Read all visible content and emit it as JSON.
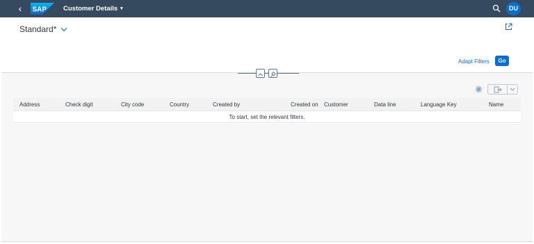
{
  "shell": {
    "back_glyph": "‹",
    "logo_text": "SAP",
    "app_title": "Customer Details",
    "caret": "▾",
    "avatar_initials": "DU",
    "bar_color": "#354a5f",
    "accent_color": "#0a6ed1"
  },
  "header": {
    "variant_name": "Standard*",
    "adapt_filters_label": "Adapt Filters",
    "go_label": "Go"
  },
  "table": {
    "columns": [
      "Address",
      "Check digit",
      "City code",
      "Country",
      "Created by",
      "Created on",
      "Customer",
      "Data line",
      "Language Key",
      "Name"
    ],
    "empty_message": "To start, set the relevant filters."
  },
  "icons": [
    "back-icon",
    "sap-logo",
    "search-icon",
    "share-icon",
    "collapse-header-icon",
    "pin-header-icon",
    "settings-icon",
    "export-icon",
    "chevron-down-icon"
  ]
}
